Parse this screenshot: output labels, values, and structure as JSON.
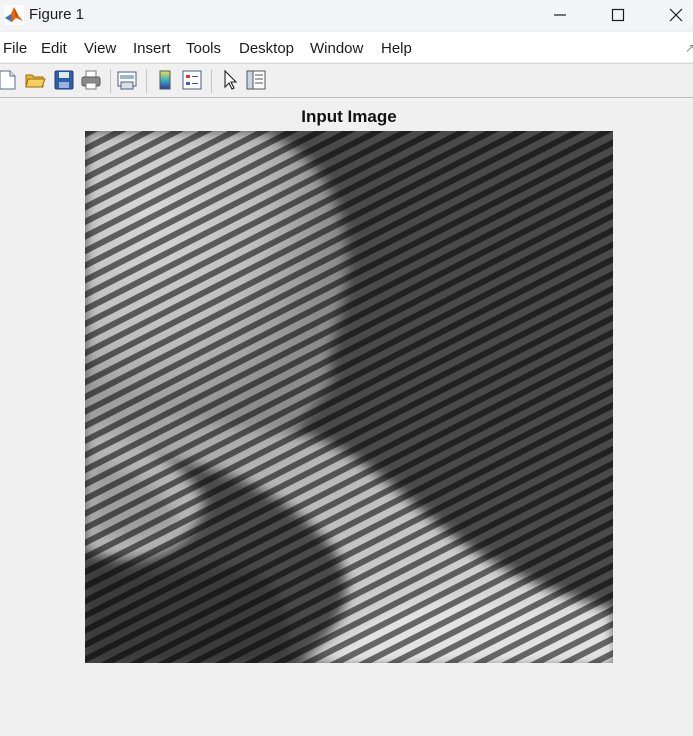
{
  "window": {
    "title": "Figure 1",
    "icon": "matlab-icon",
    "controls": [
      "minimize-icon",
      "maximize-icon",
      "close-icon"
    ]
  },
  "menu": {
    "items": [
      {
        "label": "File"
      },
      {
        "label": "Edit"
      },
      {
        "label": "View"
      },
      {
        "label": "Insert"
      },
      {
        "label": "Tools"
      },
      {
        "label": "Desktop"
      },
      {
        "label": "Window"
      },
      {
        "label": "Help"
      }
    ]
  },
  "toolbar": {
    "buttons": [
      "new-figure-icon",
      "open-file-icon",
      "save-icon",
      "print-icon",
      "link-plot-icon",
      "insert-colorbar-icon",
      "insert-legend-icon",
      "pointer-icon",
      "property-inspector-icon"
    ]
  },
  "axes": {
    "title": "Input Image"
  },
  "colors": {
    "titlebar": "#f3f4f6",
    "menubar": "#ffffff",
    "figure_bg": "#f0f0f0"
  }
}
